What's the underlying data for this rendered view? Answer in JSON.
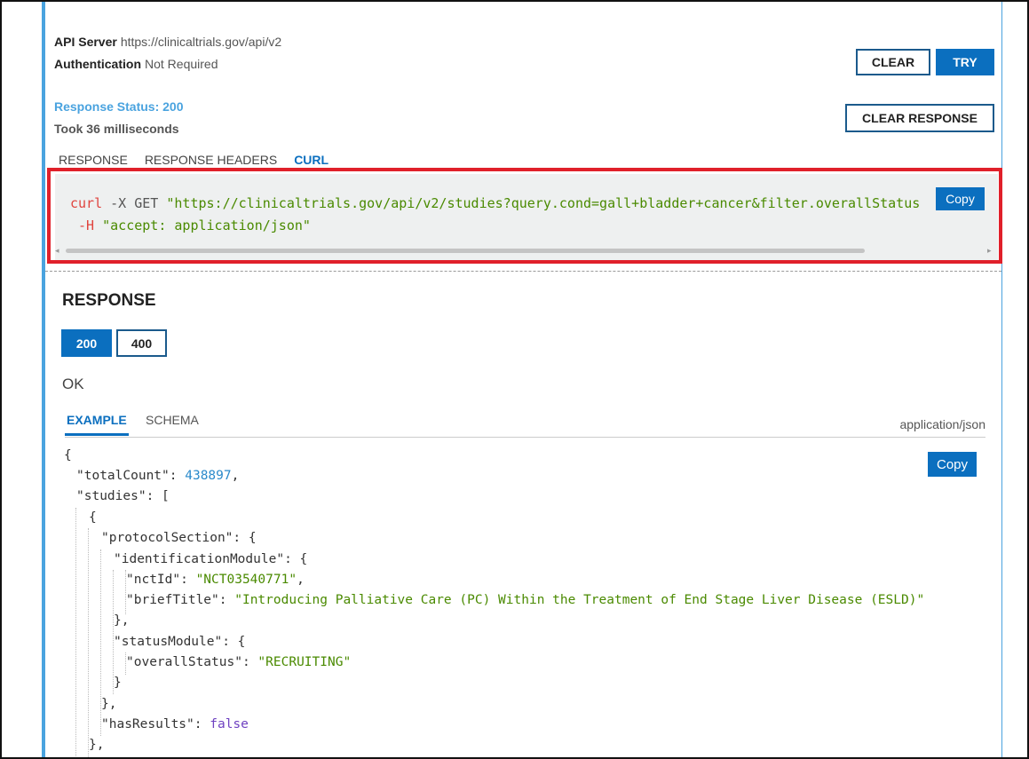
{
  "server": {
    "api_server_label": "API Server",
    "api_server_value": "https://clinicaltrials.gov/api/v2",
    "auth_label": "Authentication",
    "auth_value": "Not Required"
  },
  "actions": {
    "clear": "CLEAR",
    "try": "TRY",
    "clear_response": "CLEAR RESPONSE"
  },
  "status": {
    "response_status": "Response Status: 200",
    "took": "Took 36 milliseconds"
  },
  "response_tabs": [
    "RESPONSE",
    "RESPONSE HEADERS",
    "CURL"
  ],
  "active_response_tab": "CURL",
  "curl": {
    "cmd": "curl",
    "flag_x": " -X GET ",
    "url": "\"https://clinicaltrials.gov/api/v2/studies?query.cond=gall+bladder+cancer&filter.overallStatus",
    "flag_h": "-H",
    "header": "\"accept: application/json\"",
    "copy_label": "Copy"
  },
  "response_section": {
    "title": "RESPONSE",
    "codes": [
      "200",
      "400"
    ],
    "selected_code": "200",
    "description": "OK",
    "tabs": [
      "EXAMPLE",
      "SCHEMA"
    ],
    "active_tab": "EXAMPLE",
    "media_type": "application/json",
    "copy_label": "Copy"
  },
  "json_lines": {
    "l1": "{",
    "total_key": "\"totalCount\"",
    "total_val": "438897",
    "studies_key": "\"studies\"",
    "protocol_key": "\"protocolSection\"",
    "ident_key": "\"identificationModule\"",
    "nct_key": "\"nctId\"",
    "nct_val": "\"NCT03540771\"",
    "title_key": "\"briefTitle\"",
    "title_val": "\"Introducing Palliative Care (PC) Within the Treatment of End Stage Liver Disease (ESLD)\"",
    "status_key": "\"statusModule\"",
    "overall_key": "\"overallStatus\"",
    "overall_val": "\"RECRUITING\"",
    "has_results_key": "\"hasResults\"",
    "has_results_val": "false"
  }
}
